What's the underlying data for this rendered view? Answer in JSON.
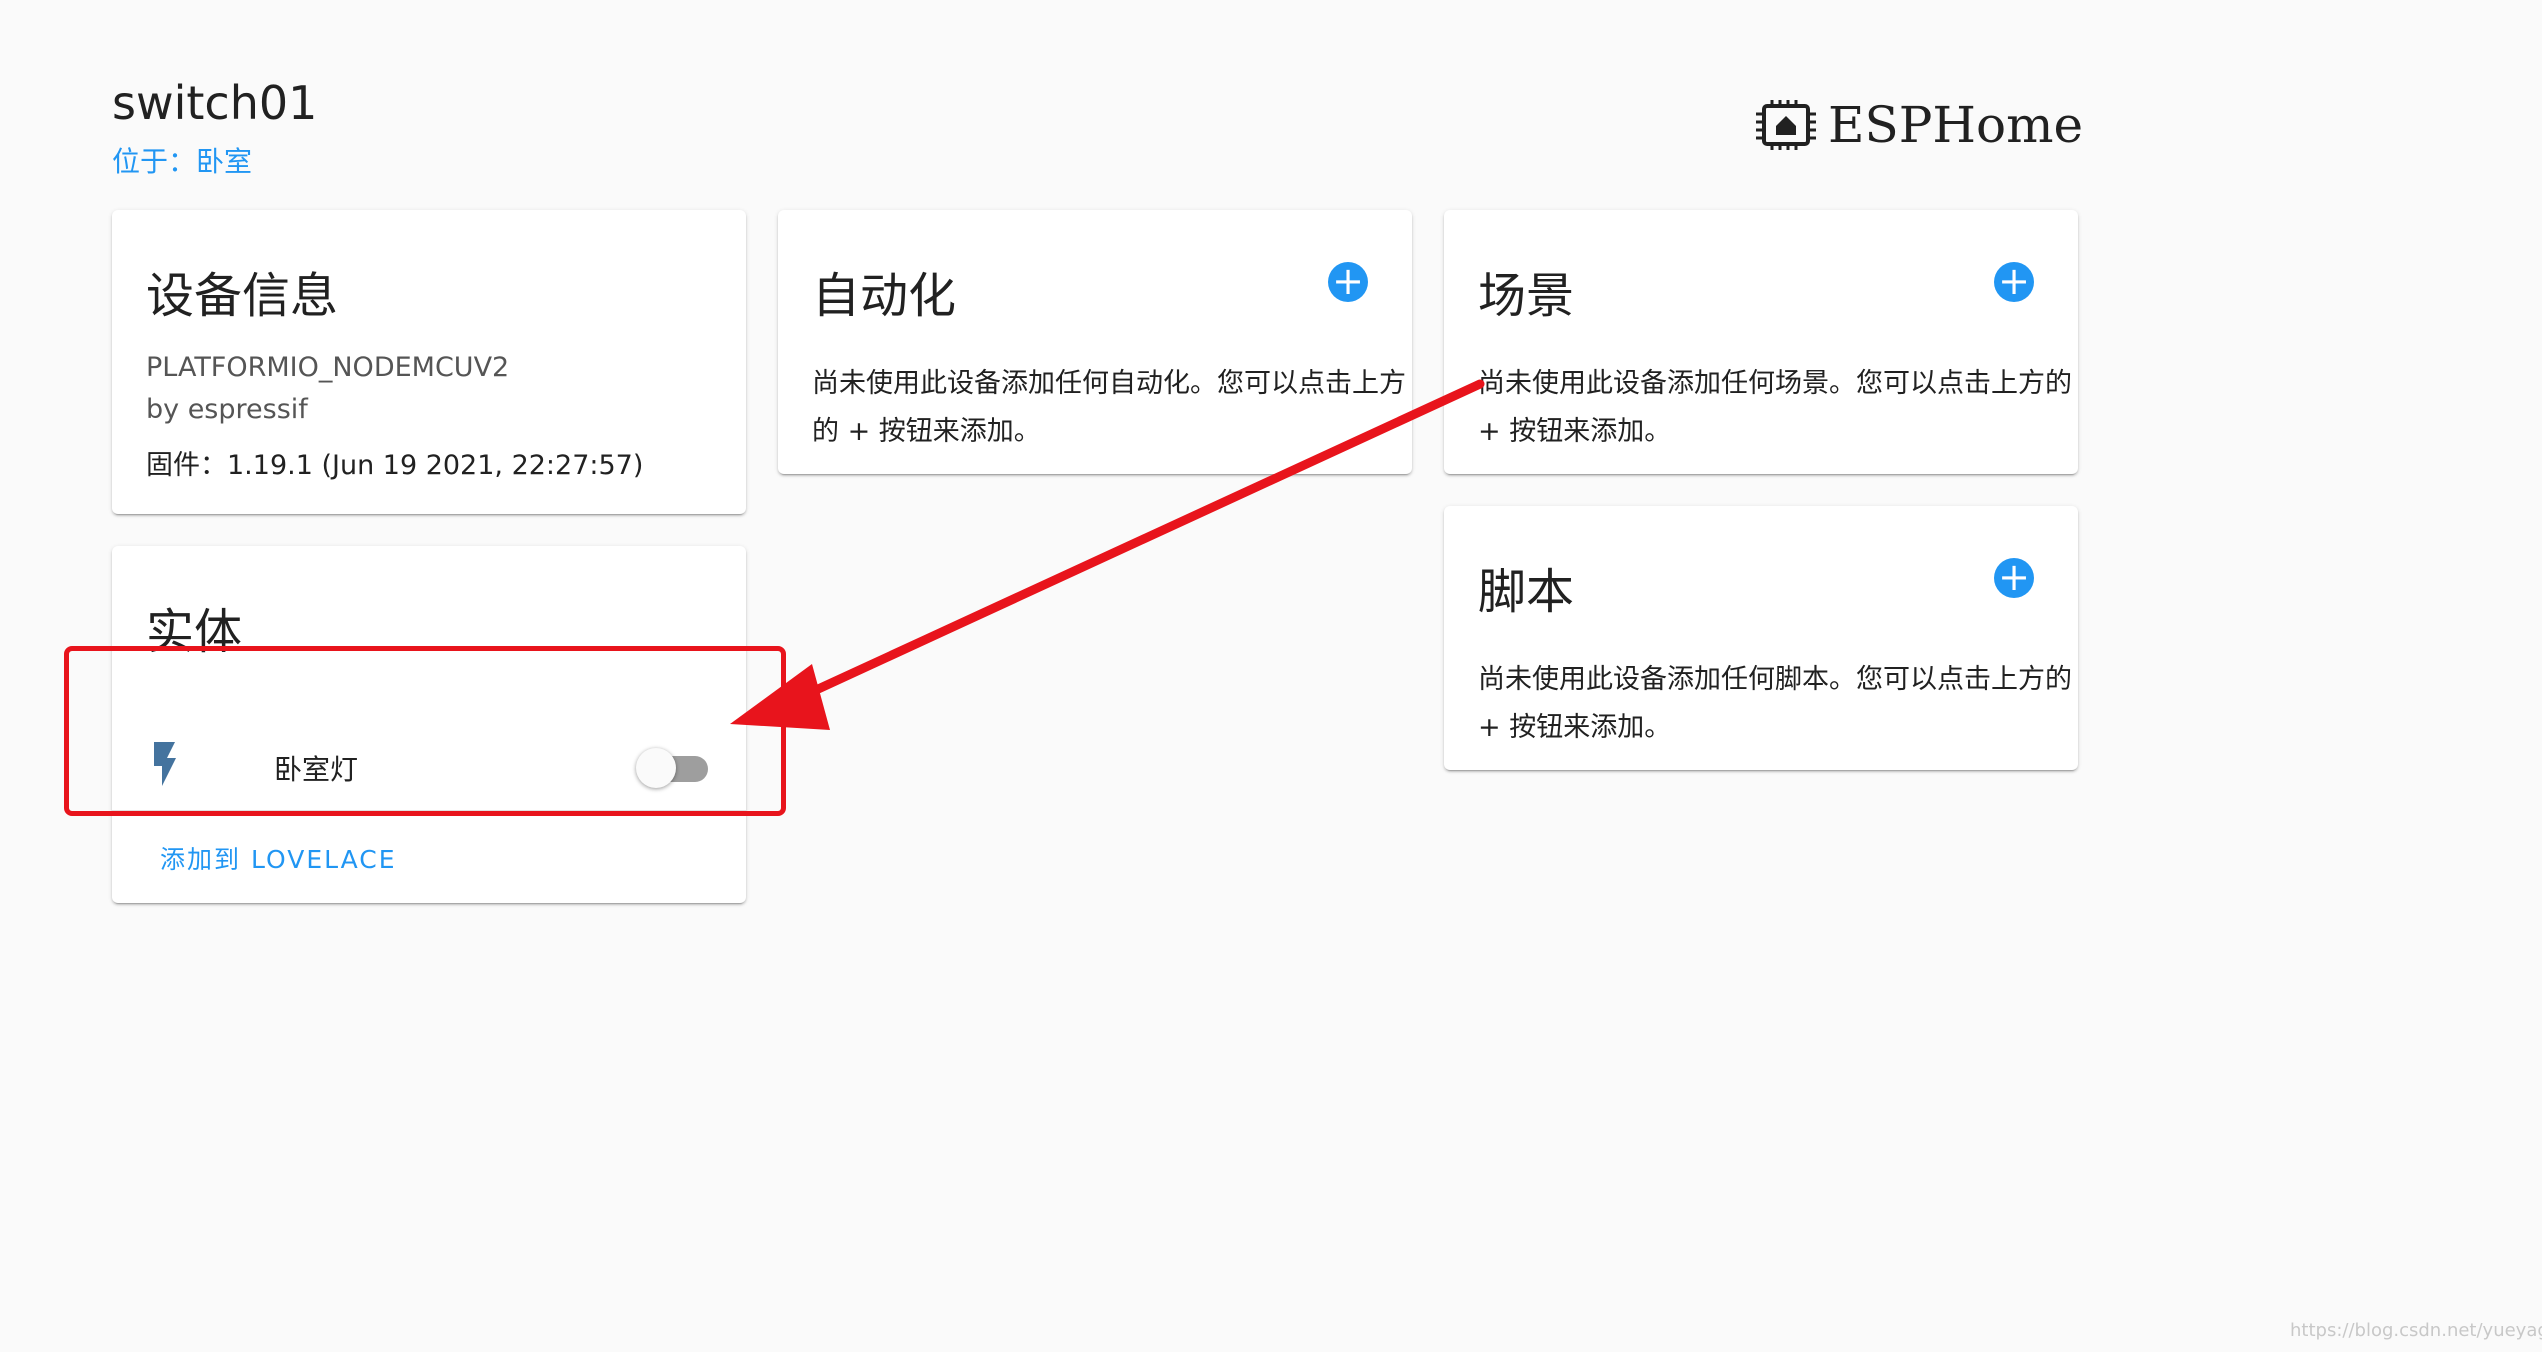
{
  "header": {
    "device_name": "switch01",
    "area": "位于：卧室",
    "logo_text": "ESPHome"
  },
  "device_info": {
    "title": "设备信息",
    "model": "PLATFORMIO_NODEMCUV2",
    "manufacturer": "by espressif",
    "firmware": "固件：1.19.1 (Jun 19 2021, 22:27:57)"
  },
  "entities": {
    "title": "实体",
    "items": [
      {
        "name": "卧室灯",
        "icon": "flash-icon",
        "state": "off"
      }
    ],
    "add_to_lovelace": "添加到 LOVELACE"
  },
  "automation": {
    "title": "自动化",
    "empty_text": "尚未使用此设备添加任何自动化。您可以点击上方的 + 按钮来添加。"
  },
  "scene": {
    "title": "场景",
    "empty_text": "尚未使用此设备添加任何场景。您可以点击上方的 + 按钮来添加。"
  },
  "script": {
    "title": "脚本",
    "empty_text": "尚未使用此设备添加任何脚本。您可以点击上方的 + 按钮来添加。"
  },
  "watermark": "https://blog.csdn.net/yueyagazhao",
  "colors": {
    "accent": "#2196f3",
    "annotation": "#e8141c",
    "background": "#fafafa",
    "icon": "#44739e"
  }
}
